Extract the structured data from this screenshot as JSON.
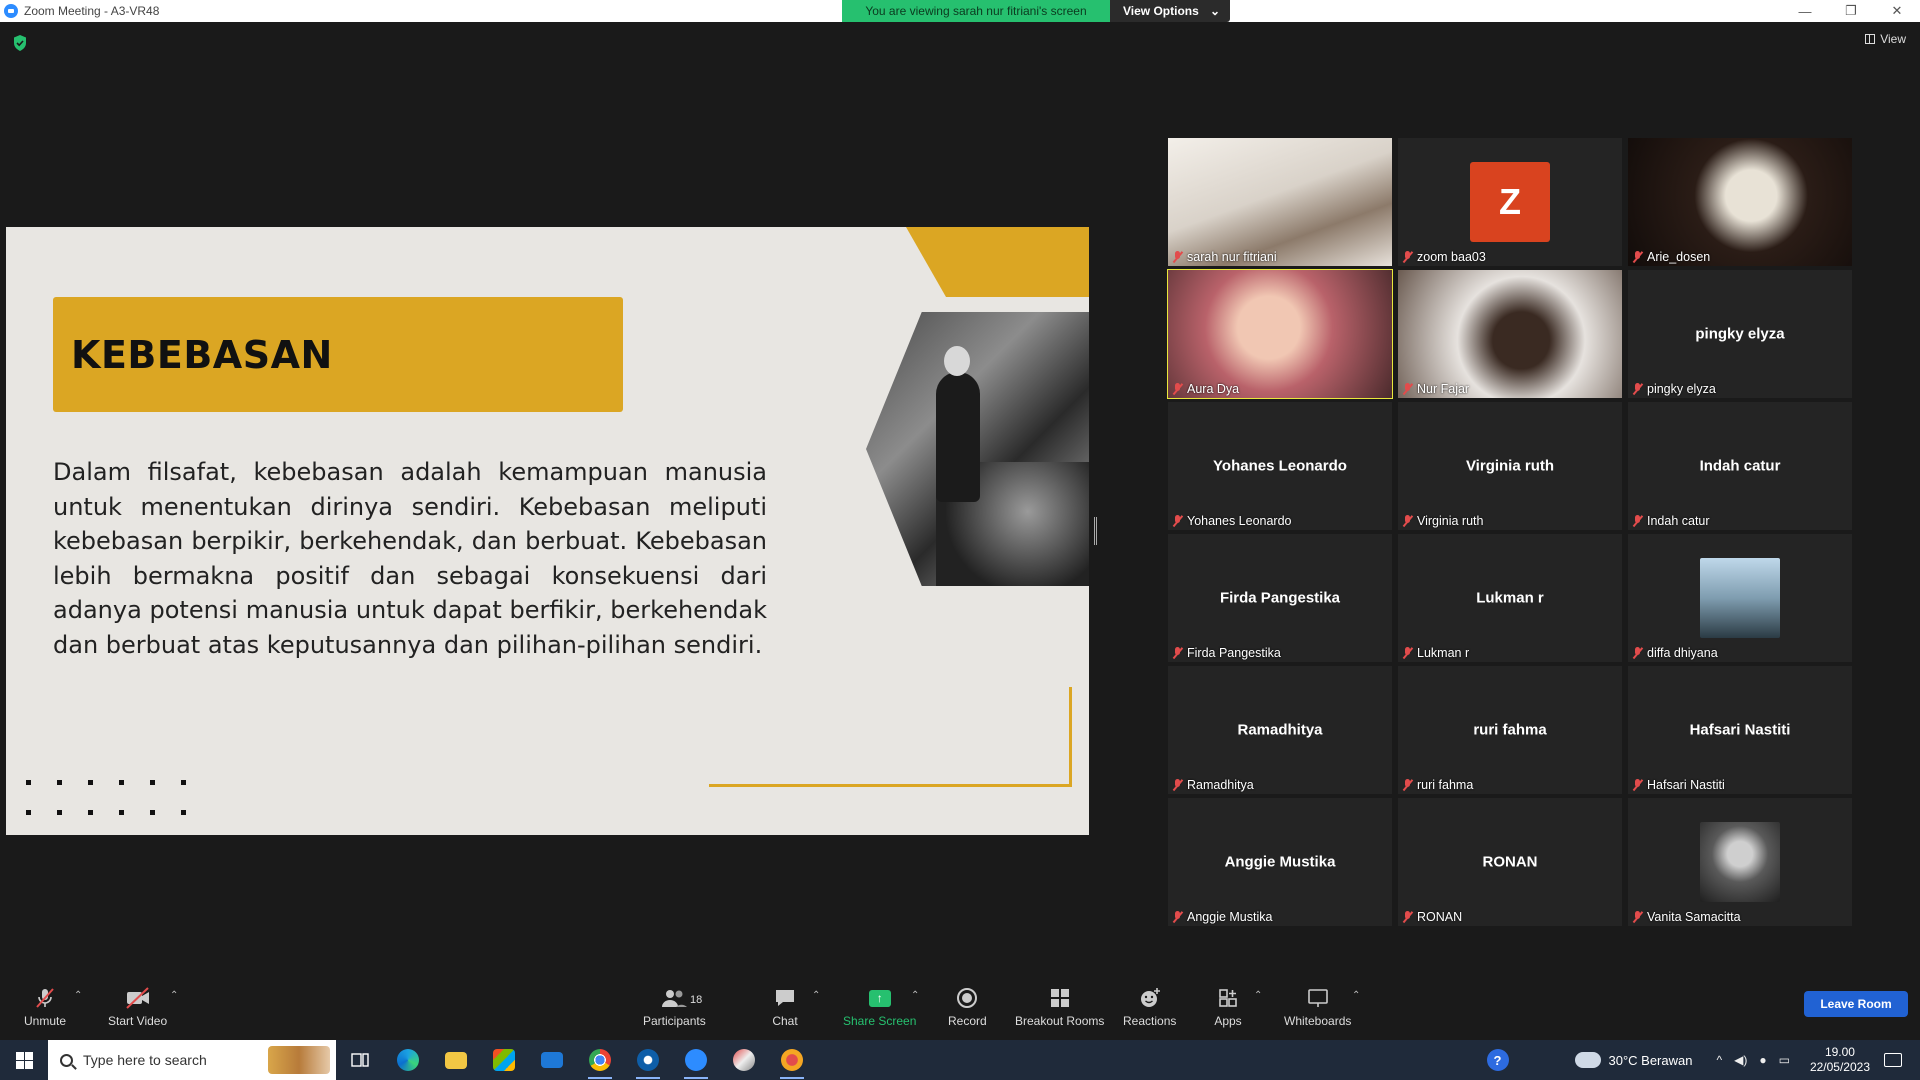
{
  "window": {
    "title": "Zoom Meeting - A3-VR48",
    "controls": [
      "—",
      "❐",
      "✕"
    ]
  },
  "banner": {
    "message": "You are viewing sarah nur fitriani's screen",
    "view_options": "View Options",
    "caret": "⌄"
  },
  "view_button": "View",
  "slide": {
    "title": "KEBEBASAN",
    "body": "Dalam filsafat, kebebasan adalah kemampuan manusia untuk menentukan dirinya sendiri. Kebebasan meliputi kebebasan berpikir, berkehendak, dan berbuat. Kebebasan lebih bermakna positif dan sebagai konsekuensi dari adanya potensi manusia untuk dapat berfikir, berkehendak dan berbuat atas keputusannya dan pilihan-pilihan sendiri.",
    "accent_color": "#dba623"
  },
  "participants": [
    {
      "name": "sarah nur fitriani",
      "display": "",
      "type": "video"
    },
    {
      "name": "zoom baa03",
      "display": "Z",
      "type": "letter"
    },
    {
      "name": "Arie_dosen",
      "display": "",
      "type": "video"
    },
    {
      "name": "Aura Dya",
      "display": "",
      "type": "video"
    },
    {
      "name": "Nur Fajar",
      "display": "",
      "type": "video"
    },
    {
      "name": "pingky elyza",
      "display": "pingky elyza",
      "type": "name"
    },
    {
      "name": "Yohanes Leonardo",
      "display": "Yohanes Leonardo",
      "type": "name"
    },
    {
      "name": "Virginia ruth",
      "display": "Virginia ruth",
      "type": "name"
    },
    {
      "name": "Indah catur",
      "display": "Indah catur",
      "type": "name"
    },
    {
      "name": "Firda Pangestika",
      "display": "Firda Pangestika",
      "type": "name"
    },
    {
      "name": "Lukman r",
      "display": "Lukman r",
      "type": "name"
    },
    {
      "name": "diffa dhiyana",
      "display": "",
      "type": "photo"
    },
    {
      "name": "Ramadhitya",
      "display": "Ramadhitya",
      "type": "name"
    },
    {
      "name": "ruri fahma",
      "display": "ruri fahma",
      "type": "name"
    },
    {
      "name": "Hafsari Nastiti",
      "display": "Hafsari Nastiti",
      "type": "name"
    },
    {
      "name": "Anggie Mustika",
      "display": "Anggie Mustika",
      "type": "name"
    },
    {
      "name": "RONAN",
      "display": "RONAN",
      "type": "name"
    },
    {
      "name": "Vanita Samacitta",
      "display": "",
      "type": "photo"
    }
  ],
  "toolbar": {
    "unmute": "Unmute",
    "start_video": "Start Video",
    "participants": "Participants",
    "participants_count": "18",
    "chat": "Chat",
    "share_screen": "Share Screen",
    "record": "Record",
    "breakout_rooms": "Breakout Rooms",
    "reactions": "Reactions",
    "apps": "Apps",
    "whiteboards": "Whiteboards",
    "leave_room": "Leave Room",
    "caret": "⌃"
  },
  "taskbar": {
    "search_placeholder": "Type here to search",
    "weather": "30°C  Berawan",
    "time": "19.00",
    "date": "22/05/2023",
    "help_icon": "?"
  }
}
